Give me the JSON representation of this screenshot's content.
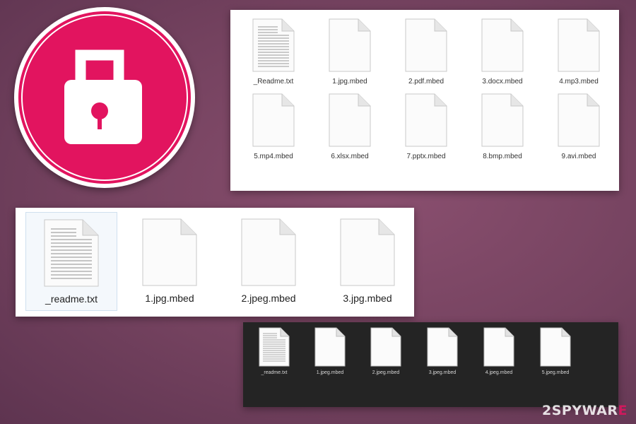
{
  "colors": {
    "background": "#74425f",
    "lock_badge": "#e2145f",
    "panel_light": "#ffffff",
    "panel_dark": "#242424",
    "watermark_accent": "#e2145f"
  },
  "lock_icon": "padlock-icon",
  "file_icon": "document-icon",
  "panel_top": {
    "files": [
      {
        "name": "_Readme.txt",
        "type": "text"
      },
      {
        "name": "1.jpg.mbed",
        "type": "blank"
      },
      {
        "name": "2.pdf.mbed",
        "type": "blank"
      },
      {
        "name": "3.docx.mbed",
        "type": "blank"
      },
      {
        "name": "4.mp3.mbed",
        "type": "blank"
      },
      {
        "name": "5.mp4.mbed",
        "type": "blank"
      },
      {
        "name": "6.xlsx.mbed",
        "type": "blank"
      },
      {
        "name": "7.pptx.mbed",
        "type": "blank"
      },
      {
        "name": "8.bmp.mbed",
        "type": "blank"
      },
      {
        "name": "9.avi.mbed",
        "type": "blank"
      }
    ]
  },
  "panel_mid": {
    "files": [
      {
        "name": "_readme.txt",
        "type": "text"
      },
      {
        "name": "1.jpg.mbed",
        "type": "blank"
      },
      {
        "name": "2.jpeg.mbed",
        "type": "blank"
      },
      {
        "name": "3.jpg.mbed",
        "type": "blank"
      }
    ]
  },
  "panel_dark": {
    "files": [
      {
        "name": "_readme.txt",
        "type": "text"
      },
      {
        "name": "1.jpeg.mbed",
        "type": "blank"
      },
      {
        "name": "2.jpeg.mbed",
        "type": "blank"
      },
      {
        "name": "3.jpeg.mbed",
        "type": "blank"
      },
      {
        "name": "4.jpeg.mbed",
        "type": "blank"
      },
      {
        "name": "5.jpeg.mbed",
        "type": "blank"
      }
    ]
  },
  "watermark": {
    "prefix": "2SPYWAR",
    "accent": "E"
  }
}
